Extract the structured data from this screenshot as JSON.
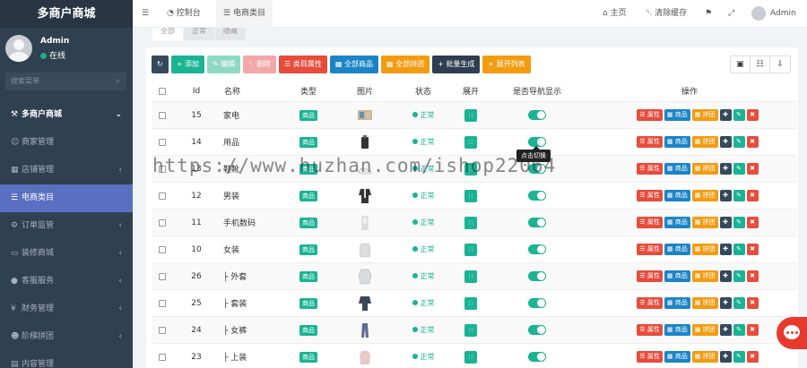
{
  "app": {
    "title": "多商户商城"
  },
  "user": {
    "name": "Admin",
    "status": "在线"
  },
  "sidebar": {
    "search_placeholder": "搜索菜单",
    "items": [
      {
        "label": "多商户商城",
        "icon": "wrench-icon"
      },
      {
        "label": "商家管理",
        "icon": "user-icon"
      },
      {
        "label": "店铺管理",
        "icon": "store-icon"
      },
      {
        "label": "电商类目",
        "icon": "list-icon"
      },
      {
        "label": "订单监管",
        "icon": "gear-icon"
      },
      {
        "label": "装修商城",
        "icon": "monitor-icon"
      },
      {
        "label": "客服服务",
        "icon": "chat-icon"
      },
      {
        "label": "财务管理",
        "icon": "money-icon"
      },
      {
        "label": "阶梯拼团",
        "icon": "group-icon"
      },
      {
        "label": "内容管理",
        "icon": "file-icon"
      }
    ]
  },
  "topbar": {
    "dashboard": "控制台",
    "active_tab": "电商类目",
    "home": "主页",
    "clear_cache": "清除缓存",
    "admin": "Admin"
  },
  "subtabs": [
    "全部",
    "正常",
    "隐藏"
  ],
  "toolbar": {
    "add": "添加",
    "edit": "编辑",
    "delete": "删除",
    "category_attr": "类目属性",
    "all_products": "全部商品",
    "all_group": "全部拼团",
    "batch_generate": "批量生成",
    "expand_all": "展开列表"
  },
  "table": {
    "headers": {
      "id": "Id",
      "name": "名称",
      "type": "类型",
      "image": "图片",
      "status": "状态",
      "expand": "展开",
      "nav": "是否导航显示",
      "ops": "操作"
    },
    "tag_label": "商品",
    "status_label": "正常",
    "op_labels": {
      "attr": "属性",
      "product": "商品",
      "group": "拼团"
    },
    "rows": [
      {
        "id": "15",
        "name": "家电"
      },
      {
        "id": "14",
        "name": "用品"
      },
      {
        "id": "13",
        "name": "鞋靴"
      },
      {
        "id": "12",
        "name": "男装"
      },
      {
        "id": "11",
        "name": "手机数码"
      },
      {
        "id": "10",
        "name": "女装"
      },
      {
        "id": "26",
        "name": "├ 外套"
      },
      {
        "id": "25",
        "name": "├ 套装"
      },
      {
        "id": "24",
        "name": "├ 女裤"
      },
      {
        "id": "23",
        "name": "├ 上装"
      }
    ]
  },
  "tooltip": "点击切换",
  "watermark": "https://www.huzhan.com/ishop22064"
}
